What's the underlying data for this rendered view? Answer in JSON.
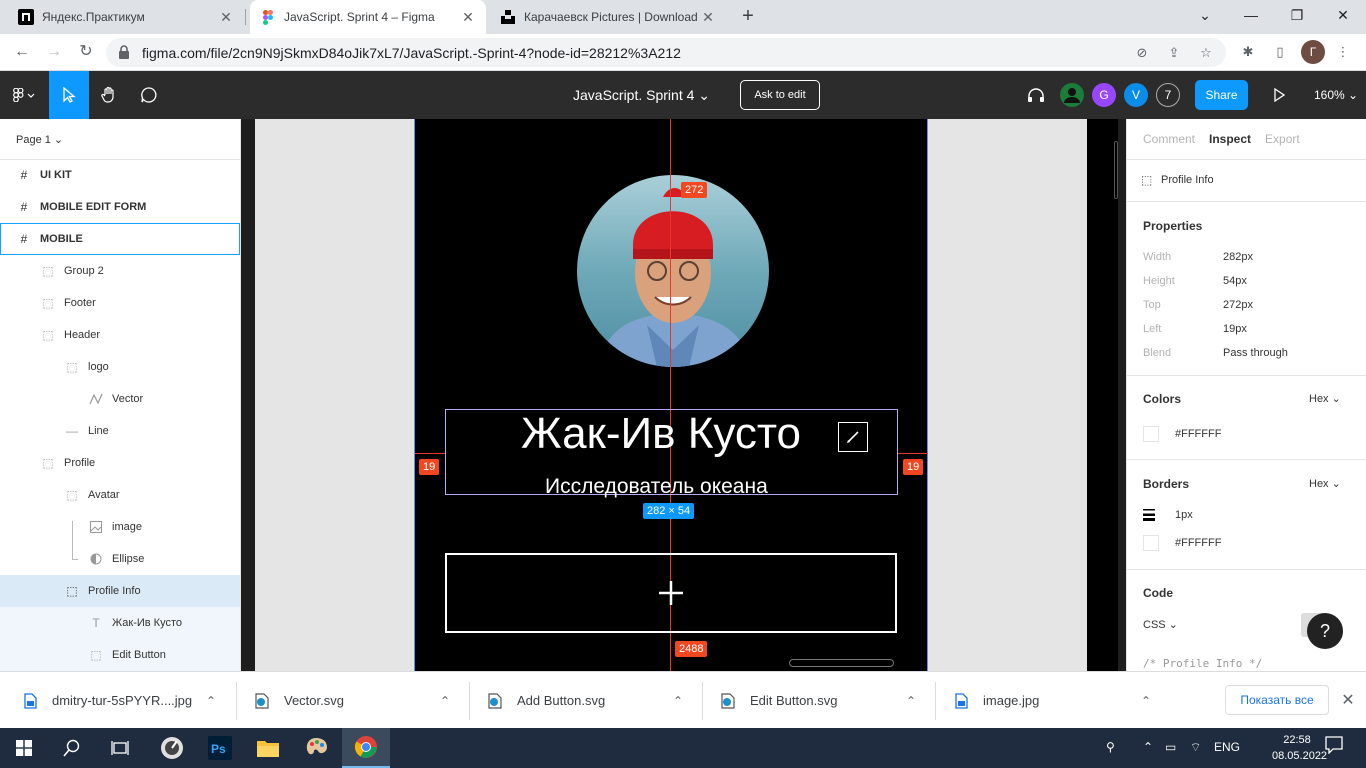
{
  "browser": {
    "tabs": [
      {
        "title": "Яндекс.Практикум",
        "active": false
      },
      {
        "title": "JavaScript. Sprint 4 – Figma",
        "active": true
      },
      {
        "title": "Карачаевск Pictures | Download",
        "active": false
      }
    ],
    "tab_close": "✕",
    "new_tab": "+",
    "url": "figma.com/file/2cn9N9jSkmxD84oJik7xL7/JavaScript.-Sprint-4?node-id=28212%3A212",
    "profile_initial": "Г"
  },
  "figma": {
    "file_name": "JavaScript. Sprint 4",
    "ask_to_edit": "Ask to edit",
    "users": [
      {
        "initial": "",
        "color": "#1c7c3a"
      },
      {
        "initial": "G",
        "color": "#9747ff"
      },
      {
        "initial": "V",
        "color": "#0c8ce9"
      },
      {
        "initial": "7",
        "color": "#2c2c2c"
      }
    ],
    "share": "Share",
    "zoom": "160%",
    "page": "Page 1 ⌄",
    "layers": [
      {
        "name": "UI KIT",
        "type": "frame",
        "depth": 0
      },
      {
        "name": "MOBILE EDIT FORM",
        "type": "frame",
        "depth": 0
      },
      {
        "name": "MOBILE",
        "type": "frame",
        "depth": 0
      },
      {
        "name": "Group 2",
        "type": "group",
        "depth": 1
      },
      {
        "name": "Footer",
        "type": "group",
        "depth": 1
      },
      {
        "name": "Header",
        "type": "group",
        "depth": 1
      },
      {
        "name": "logo",
        "type": "group",
        "depth": 2
      },
      {
        "name": "Vector",
        "type": "vector",
        "depth": 3
      },
      {
        "name": "Line",
        "type": "line",
        "depth": 2
      },
      {
        "name": "Profile",
        "type": "group",
        "depth": 1
      },
      {
        "name": "Avatar",
        "type": "group",
        "depth": 2
      },
      {
        "name": "image",
        "type": "image",
        "depth": 3
      },
      {
        "name": "Ellipse",
        "type": "ellipse",
        "depth": 3
      },
      {
        "name": "Profile Info",
        "type": "group",
        "depth": 2
      },
      {
        "name": "Жак-Ив Кусто",
        "type": "text",
        "depth": 3
      },
      {
        "name": "Edit Button",
        "type": "group",
        "depth": 3
      }
    ],
    "canvas": {
      "profile_name": "Жак-Ив Кусто",
      "profile_job": "Исследователь океана",
      "badge_top": "272",
      "badge_left": "19",
      "badge_right": "19",
      "size_badge": "282 × 54",
      "badge_bottom": "2488",
      "add_icon": "+"
    },
    "inspect": {
      "tabs": [
        "Comment",
        "Inspect",
        "Export"
      ],
      "selection": "Profile Info",
      "properties_title": "Properties",
      "properties": [
        {
          "label": "Width",
          "value": "282px"
        },
        {
          "label": "Height",
          "value": "54px"
        },
        {
          "label": "Top",
          "value": "272px"
        },
        {
          "label": "Left",
          "value": "19px"
        },
        {
          "label": "Blend",
          "value": "Pass through"
        }
      ],
      "colors_title": "Colors",
      "hex": "Hex ⌄",
      "color_value": "#FFFFFF",
      "borders_title": "Borders",
      "border_width": "1px",
      "border_color": "#FFFFFF",
      "code_title": "Code",
      "code_lang": "CSS ⌄",
      "code_comment": "/* Profile Info */",
      "help": "?"
    }
  },
  "downloads": {
    "items": [
      "dmitry-tur-5sPYYR....jpg",
      "Vector.svg",
      "Add Button.svg",
      "Edit Button.svg",
      "image.jpg"
    ],
    "caret": "⌃",
    "show_all": "Показать все",
    "close": "✕"
  },
  "taskbar": {
    "lang": "ENG",
    "time": "22:58",
    "date": "08.05.2022"
  },
  "colors": {
    "figma_blue": "#0d99ff",
    "measure_red": "#f24822",
    "canvas_bg": "#e5e5e5"
  }
}
